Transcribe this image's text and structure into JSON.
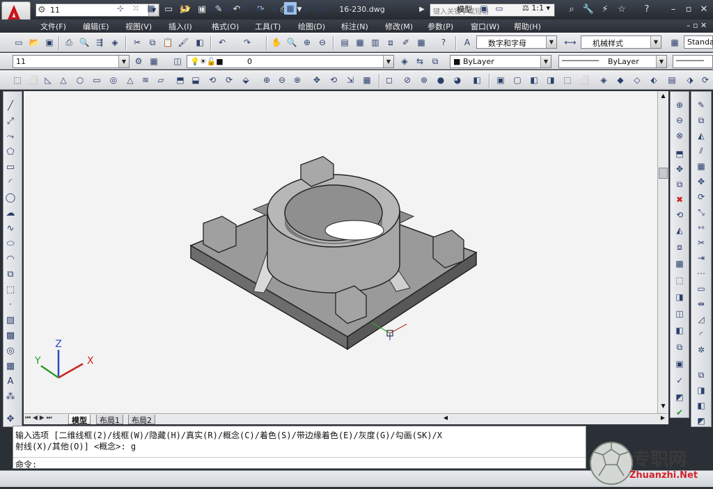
{
  "app": {
    "logo_letter": "A",
    "workspace": "11",
    "doc_title": "16-230.dwg",
    "search_placeholder": "键入关键字或短语"
  },
  "menu": [
    "文件(F)",
    "编辑(E)",
    "视图(V)",
    "插入(I)",
    "格式(O)",
    "工具(T)",
    "绘图(D)",
    "标注(N)",
    "修改(M)",
    "参数(P)",
    "窗口(W)",
    "帮助(H)"
  ],
  "styles": {
    "text_style": "数字和字母",
    "dim_style": "机械样式",
    "table_style": "Standa"
  },
  "layers": {
    "layer_state": "11",
    "current_layer": "0",
    "color": "ByLayer",
    "linetype": "ByLayer"
  },
  "ucs": {
    "x": "X",
    "y": "Y",
    "z": "Z"
  },
  "tabs": [
    "模型",
    "布局1",
    "布局2"
  ],
  "command": {
    "line1": "输入选项 [二维线框(2)/线框(W)/隐藏(H)/真实(R)/概念(C)/着色(S)/带边缘着色(E)/灰度(G)/勾画(SK)/X",
    "line2": "射线(X)/其他(O)] <概念>: g",
    "prompt": "命令:"
  },
  "status": {
    "model": "模型",
    "scale": "1:1"
  },
  "watermark": {
    "name": "专职网",
    "url": "Zhuanzhi.Net"
  },
  "colors": {
    "accent": "#cc1b1b",
    "title_bg": "#2b2f36",
    "canvas": "#f3f3f3"
  }
}
